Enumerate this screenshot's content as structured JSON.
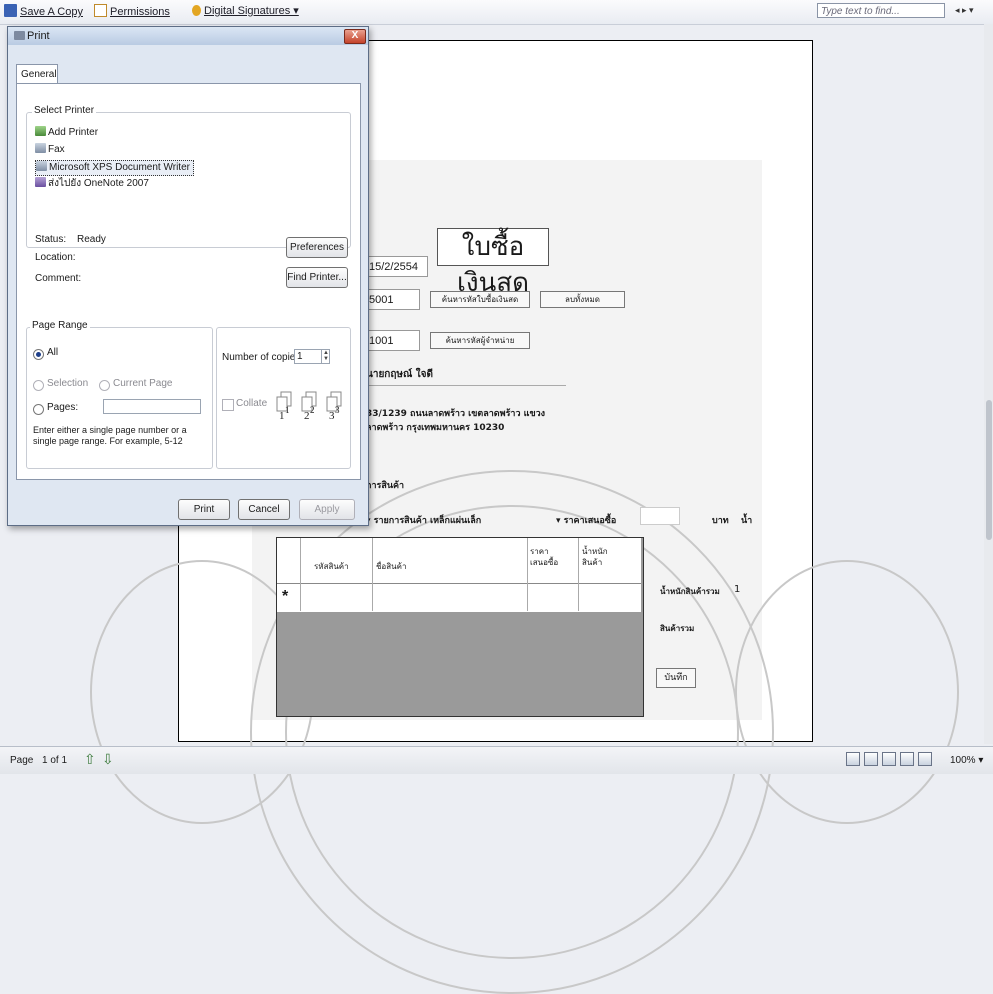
{
  "toolbar": {
    "save_label": "Save A Copy",
    "permissions_label": "Permissions",
    "signatures_label": "Digital Signatures ▾",
    "find_placeholder": "Type text to find...",
    "find_arrows": "◂ ▸ ▾"
  },
  "dialog": {
    "title": "Print",
    "close_label": "X",
    "tab_general": "General",
    "select_printer_label": "Select Printer",
    "printers": [
      "Add Printer",
      "Fax",
      "Microsoft XPS Document Writer",
      "ส่งไปยัง OneNote 2007"
    ],
    "status_label": "Status:",
    "status_value": "Ready",
    "location_label": "Location:",
    "comment_label": "Comment:",
    "preferences_button": "Preferences",
    "find_printer_button": "Find Printer...",
    "page_range_label": "Page Range",
    "all_label": "All",
    "selection_label": "Selection",
    "current_page_label": "Current Page",
    "pages_label": "Pages:",
    "pages_hint": "Enter either a single page number or a single page range.  For example, 5-12",
    "copies_label": "Number of copies:",
    "copies_value": "1",
    "collate_label": "Collate",
    "print_button": "Print",
    "cancel_button": "Cancel",
    "apply_button": "Apply"
  },
  "document": {
    "title": "ใบซื้อเงินสด",
    "date_value": "15/2/2554",
    "receipt_no": "5001",
    "search_receipt_button": "ค้นหารหัสใบซื้อเงินสด",
    "clear_button": "ลบทั้งหมด",
    "supplier_code": "1001",
    "search_supplier_button": "ค้นหารหัสผู้จำหน่าย",
    "supplier_name": "นายกฤษณ์ ใจดี",
    "address_line1": "33/1239 ถนนลาดพร้าว เขตลาดพร้าว แขวง",
    "address_line2": "ลาดพร้าว กรุงเทพมหานคร 10230",
    "section_label": "การสินค้า",
    "product_list_label": "▾ รายการสินค้า  เหล็กแผ่นเล็ก",
    "offer_price_label": "▾ ราคาเสนอซื้อ",
    "baht_label": "บาท",
    "weight_short": "น้ำ",
    "grid_headers": [
      "รหัสสินค้า",
      "ชื่อสินค้า",
      "ราคา เสนอซื้อ",
      "น้ำหนัก สินค้า"
    ],
    "grid_new_row": "*",
    "total_weight_label": "น้ำหนักสินค้ารวม",
    "total_weight_value": "1",
    "total_goods_label": "สินค้ารวม",
    "save_button": "บันทึก"
  },
  "statusbar": {
    "page_label": "Page",
    "page_value": "1 of 1",
    "zoom": "100%  ▾"
  }
}
